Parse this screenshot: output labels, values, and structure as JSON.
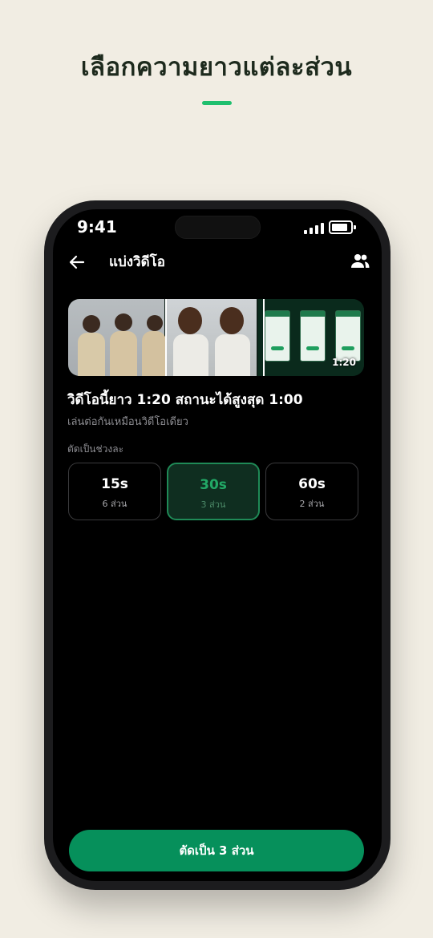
{
  "headline": "เลือกความยาวแต่ละส่วน",
  "status_bar": {
    "time": "9:41"
  },
  "nav": {
    "title": "แบ่งวิดีโอ"
  },
  "timeline": {
    "duration": "1:20"
  },
  "info": {
    "title": "วิดีโอนี้ยาว 1:20 สถานะได้สูงสุด 1:00",
    "subtitle": "เล่นต่อกันเหมือนวิดีโอเดียว"
  },
  "segment_label": "ตัดเป็นช่วงละ",
  "options": [
    {
      "value": "15s",
      "count": "6 ส่วน",
      "selected": false
    },
    {
      "value": "30s",
      "count": "3 ส่วน",
      "selected": true
    },
    {
      "value": "60s",
      "count": "2 ส่วน",
      "selected": false
    }
  ],
  "cta_label": "ตัดเป็น 3 ส่วน",
  "colors": {
    "background": "#f1ede3",
    "accent": "#1fbf6e",
    "primary_button": "#06905b",
    "selected_border": "#1f8a57"
  },
  "icons": {
    "back": "arrow-left-icon",
    "group": "group-icon",
    "signal": "signal-icon",
    "battery": "battery-icon"
  }
}
